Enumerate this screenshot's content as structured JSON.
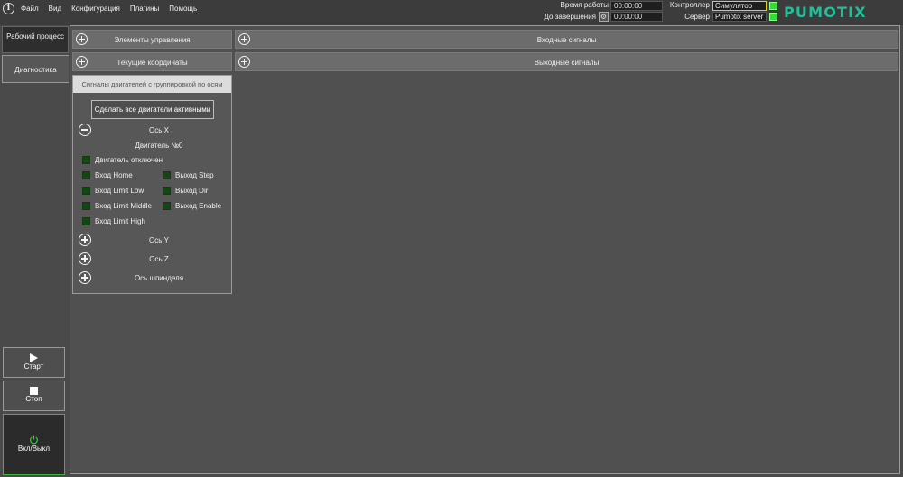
{
  "menu": [
    "Файл",
    "Вид",
    "Конфигурация",
    "Плагины",
    "Помощь"
  ],
  "status": {
    "work_time_label": "Время работы",
    "work_time_value": "00:00:00",
    "to_finish_label": "До завершения",
    "to_finish_value": "00:00:00",
    "controller_label": "Контроллер",
    "controller_value": "Симулятор",
    "server_label": "Сервер",
    "server_value": "Pumotix server",
    "led_color": "#33dd33"
  },
  "logo": {
    "text": "PUMOTIX",
    "color": "#1fbf9a"
  },
  "sidebar": {
    "tabs": [
      "Рабочий процесс",
      "Диагностика"
    ],
    "start_label": "Старт",
    "stop_label": "Стоп",
    "power_label": "Вкл/Выкл"
  },
  "sections": {
    "controls": "Элементы управления",
    "coords": "Текущие координаты",
    "inputs": "Входные сигналы",
    "outputs": "Выходные сигналы"
  },
  "motor_panel": {
    "title": "Сигналы двигателей с группировкой по осям",
    "make_active_button": "Сделать все двигатели активными",
    "axis_x": "Ось X",
    "motor_title": "Двигатель №0",
    "motor_disabled": "Двигатель отключен",
    "signals_left": [
      "Вход Home",
      "Вход Limit Low",
      "Вход Limit Middle",
      "Вход Limit High"
    ],
    "signals_right": [
      "Выход Step",
      "Выход Dir",
      "Выход Enable"
    ],
    "axis_y": "Ось Y",
    "axis_z": "Ось Z",
    "axis_spindle": "Ось шпинделя"
  },
  "signal_off_color": "#0f4a0f"
}
